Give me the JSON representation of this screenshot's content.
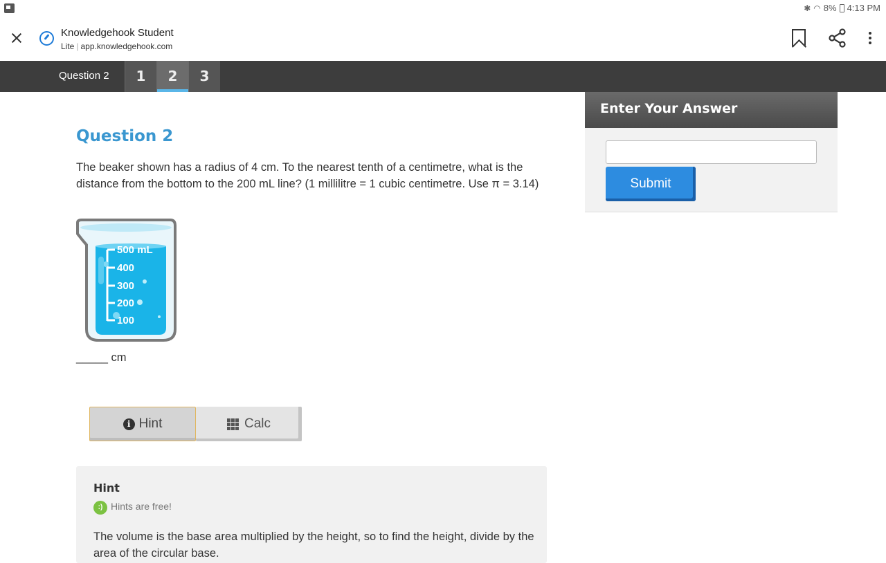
{
  "status_bar": {
    "battery": "8%",
    "time": "4:13 PM",
    "icons": [
      "bluetooth-icon",
      "wifi-icon",
      "battery-icon"
    ]
  },
  "browser": {
    "title": "Knowledgehook Student",
    "mode": "Lite",
    "url": "app.knowledgehook.com",
    "icons": [
      "close-icon",
      "lite-mode-icon",
      "bookmark-icon",
      "share-icon",
      "more-vert-icon"
    ]
  },
  "question_nav": {
    "label": "Question 2",
    "tabs": [
      "1",
      "2",
      "3"
    ],
    "active_tab": "2"
  },
  "question": {
    "title": "Question 2",
    "text": "The beaker shown has a radius of 4 cm. To the nearest tenth of a centimetre, what is the distance from the bottom to the 200 mL line? (1 millilitre = 1 cubic centimetre. Use π = 3.14)",
    "beaker_labels": [
      "500 mL",
      "400",
      "300",
      "200",
      "100"
    ],
    "answer_line": "_____ cm"
  },
  "buttons": {
    "hint": "Hint",
    "calc": "Calc"
  },
  "hint_panel": {
    "heading": "Hint",
    "badge": ":)",
    "note": "Hints are free!",
    "body": "The volume is the base area multiplied by the height, so to find the height, divide by the area of the circular base."
  },
  "answer_panel": {
    "title": "Enter Your Answer",
    "input_value": "",
    "submit_label": "Submit"
  },
  "colors": {
    "accent_blue": "#3a97d0",
    "submit_blue": "#2d8ce0",
    "nav_dark": "#3d3d3d",
    "active_tab_underline": "#5ab6e8",
    "hint_badge_green": "#7cc242",
    "beaker_water": "#1ab4e8"
  }
}
